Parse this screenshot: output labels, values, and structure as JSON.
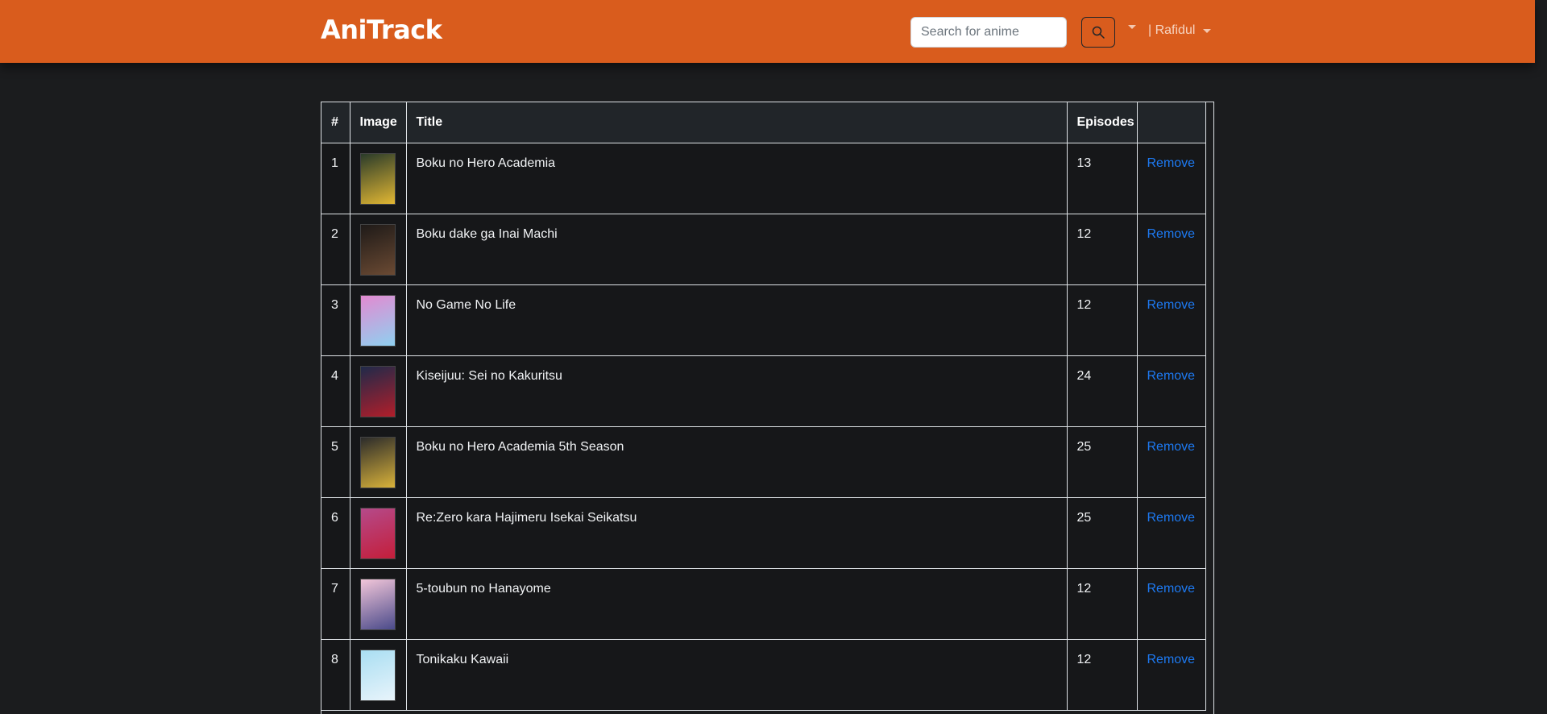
{
  "navbar": {
    "brand": "AniTrack",
    "search_placeholder": "Search for anime",
    "user_label": "| Rafidul"
  },
  "table": {
    "headers": [
      "#",
      "Image",
      "Title",
      "Episodes",
      ""
    ],
    "remove_label": "Remove",
    "rows": [
      {
        "num": "1",
        "title": "Boku no Hero Academia",
        "episodes": "13",
        "colors": [
          "#2a3b2a",
          "#e2b733"
        ]
      },
      {
        "num": "2",
        "title": "Boku dake ga Inai Machi",
        "episodes": "12",
        "colors": [
          "#1e1a18",
          "#6b4a33"
        ]
      },
      {
        "num": "3",
        "title": "No Game No Life",
        "episodes": "12",
        "colors": [
          "#e38ad1",
          "#8fd0f0"
        ]
      },
      {
        "num": "4",
        "title": "Kiseijuu: Sei no Kakuritsu",
        "episodes": "24",
        "colors": [
          "#1f2a4a",
          "#b21e2a"
        ]
      },
      {
        "num": "5",
        "title": "Boku no Hero Academia 5th Season",
        "episodes": "25",
        "colors": [
          "#2b2b2b",
          "#d9b23a"
        ]
      },
      {
        "num": "6",
        "title": "Re:Zero kara Hajimeru Isekai Seikatsu",
        "episodes": "25",
        "colors": [
          "#b54a8a",
          "#c41e3a"
        ]
      },
      {
        "num": "7",
        "title": "5-toubun no Hanayome",
        "episodes": "12",
        "colors": [
          "#f2c6d9",
          "#4a4a8a"
        ]
      },
      {
        "num": "8",
        "title": "Tonikaku Kawaii",
        "episodes": "12",
        "colors": [
          "#a9def2",
          "#e8f4fb"
        ]
      }
    ]
  },
  "colors": {
    "navbar_bg": "#d95c1d",
    "page_bg": "#1b1c1e",
    "link": "#1d7af3"
  }
}
